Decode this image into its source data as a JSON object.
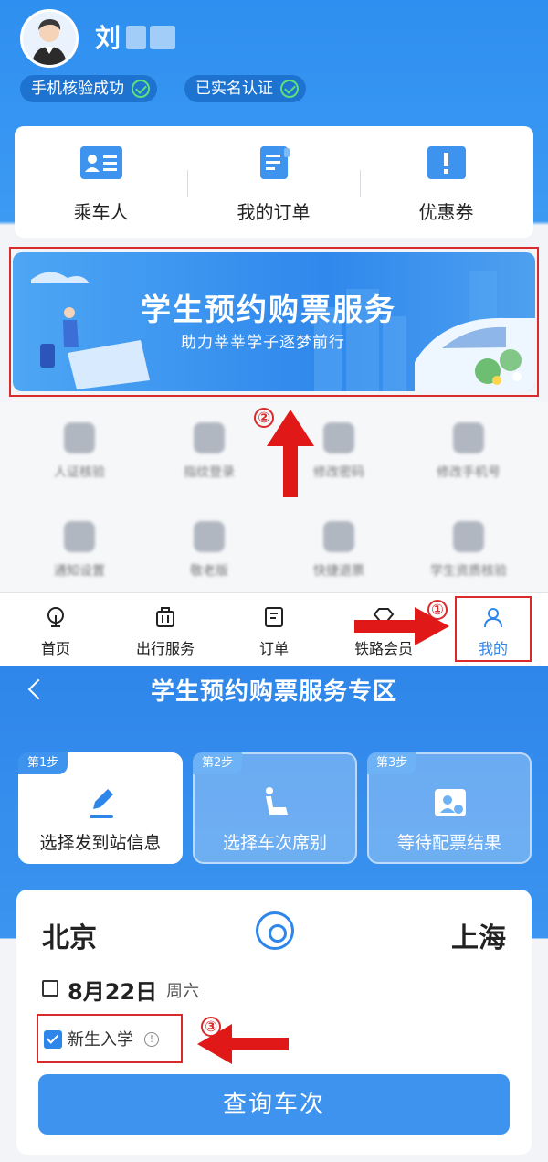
{
  "profile": {
    "name": "刘",
    "badges": [
      {
        "label": "手机核验成功"
      },
      {
        "label": "已实名认证"
      }
    ]
  },
  "quick_actions": [
    {
      "label": "乘车人",
      "icon": "id-card-icon"
    },
    {
      "label": "我的订单",
      "icon": "order-doc-icon"
    },
    {
      "label": "优惠券",
      "icon": "coupon-icon"
    }
  ],
  "banner": {
    "title": "学生预约购票服务",
    "subtitle": "助力莘莘学子逐梦前行"
  },
  "service_grid": [
    {
      "label": "人证核验"
    },
    {
      "label": "指纹登录"
    },
    {
      "label": "修改密码"
    },
    {
      "label": "修改手机号"
    },
    {
      "label": "通知设置"
    },
    {
      "label": "敬老版"
    },
    {
      "label": "快捷退票"
    },
    {
      "label": "学生资质核验"
    }
  ],
  "tabbar": [
    {
      "label": "首页",
      "icon": "home-icon"
    },
    {
      "label": "出行服务",
      "icon": "luggage-icon"
    },
    {
      "label": "订单",
      "icon": "order-icon"
    },
    {
      "label": "铁路会员",
      "icon": "diamond-icon"
    },
    {
      "label": "我的",
      "icon": "person-icon",
      "active": true
    }
  ],
  "annotations": {
    "step1": "①",
    "step2": "②",
    "step3": "③"
  },
  "zone": {
    "title": "学生预约购票服务专区",
    "steps": [
      {
        "num": "第1步",
        "label": "选择发到站信息",
        "active": true
      },
      {
        "num": "第2步",
        "label": "选择车次席别"
      },
      {
        "num": "第3步",
        "label": "等待配票结果"
      }
    ],
    "from": "北京",
    "to": "上海",
    "date": "8月22日",
    "weekday": "周六",
    "checkbox_label": "新生入学",
    "query_button": "查询车次"
  },
  "colors": {
    "primary": "#2f86ea",
    "annotation_red": "#d92b2b"
  }
}
